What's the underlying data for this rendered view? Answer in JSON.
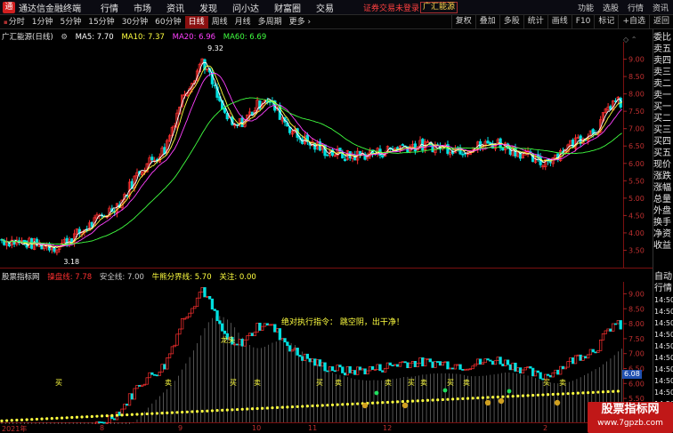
{
  "app": {
    "name": "通达信金融终端",
    "menu": [
      "行情",
      "市场",
      "资讯",
      "发现",
      "问小达",
      "财富圈",
      "交易"
    ],
    "login_status": "证券交易未登录",
    "current_stock_pill": "广汇能源",
    "right_buttons": [
      "功能",
      "选股",
      "行情",
      "资讯"
    ]
  },
  "toolbar": {
    "periods": [
      "分时",
      "1分钟",
      "5分钟",
      "15分钟",
      "30分钟",
      "60分钟",
      "日线",
      "周线",
      "月线",
      "多周期",
      "更多"
    ],
    "active_period": "日线",
    "tools": [
      "复权",
      "叠加",
      "多股",
      "统计",
      "画线",
      "F10",
      "标记",
      "+自选",
      "返回"
    ]
  },
  "main_chart": {
    "stock_title": "广汇能源(日线)",
    "ma": [
      {
        "label": "MA5: 7.70",
        "color": "#ffffff"
      },
      {
        "label": "MA10: 7.37",
        "color": "#ffff40"
      },
      {
        "label": "MA20: 6.96",
        "color": "#ff40ff"
      },
      {
        "label": "MA60: 6.69",
        "color": "#40ff40"
      }
    ],
    "price_ticks": [
      "9.00",
      "8.50",
      "8.00",
      "7.50",
      "7.00",
      "6.50",
      "6.00",
      "5.50",
      "5.00",
      "4.50",
      "4.00",
      "3.50"
    ],
    "high_label": "9.32",
    "low_label": "3.18"
  },
  "indicator": {
    "name": "股票指标网",
    "items": [
      {
        "label": "操盘线: 7.78",
        "color": "#ff3030"
      },
      {
        "label": "安全线: 7.00",
        "color": "#c8c8c8"
      },
      {
        "label": "牛熊分界线: 5.70",
        "color": "#ffff40"
      },
      {
        "label": "关注: 0.00",
        "color": "#ffff40"
      }
    ],
    "command_text": "绝对执行指令：  跳空阴，出干净！",
    "price_ticks": [
      "9.00",
      "8.50",
      "8.00",
      "7.50",
      "7.00",
      "6.50",
      "6.00",
      "5.50",
      "5.00"
    ],
    "current_value": "6.08",
    "signals": {
      "buy": "买",
      "sell": "卖",
      "dragon": "龙头"
    }
  },
  "side_panel": {
    "order_book": [
      "委比",
      "卖五",
      "卖四",
      "卖三",
      "卖二",
      "卖一",
      "买一",
      "买二",
      "买三",
      "买四",
      "买五",
      "现价",
      "涨跌",
      "涨幅",
      "总量",
      "外盘",
      "换手",
      "净资",
      "收益"
    ],
    "tick_header": [
      "自动",
      "行情"
    ],
    "tick_times": [
      "14:50",
      "14:50",
      "14:50",
      "14:50",
      "14:50",
      "14:50",
      "14:50",
      "14:50",
      "14:50",
      "14:50",
      "14:51"
    ]
  },
  "date_axis": [
    "2021年",
    "8",
    "9",
    "10",
    "11",
    "12",
    "2"
  ],
  "watermark": {
    "line1": "股票指标网",
    "line2": "www.7gpzb.com"
  },
  "colors": {
    "up": "#ff3030",
    "down": "#00e0e0",
    "ma5": "#ffffff",
    "ma10": "#ffff40",
    "ma20": "#ff40ff",
    "ma60": "#40ff40"
  }
}
